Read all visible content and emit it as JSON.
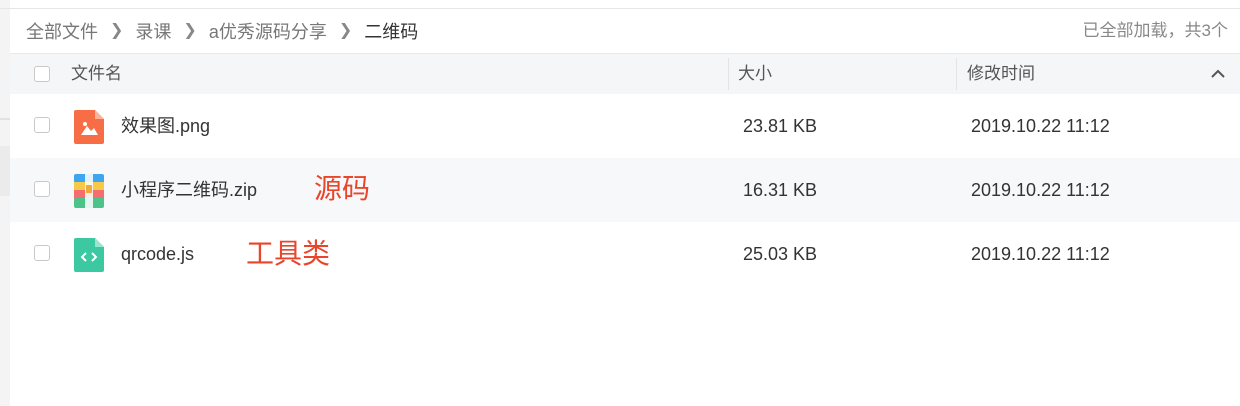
{
  "breadcrumb": {
    "items": [
      "全部文件",
      "录课",
      "a优秀源码分享",
      "二维码"
    ],
    "separator": ">"
  },
  "load_status": "已全部加载，共3个",
  "table": {
    "columns": {
      "name": "文件名",
      "size": "大小",
      "modified": "修改时间"
    },
    "rows": [
      {
        "name": "效果图.png",
        "size": "23.81 KB",
        "modified": "2019.10.22 11:12",
        "icon": "image-file-icon",
        "annotation": ""
      },
      {
        "name": "小程序二维码.zip",
        "size": "16.31 KB",
        "modified": "2019.10.22 11:12",
        "icon": "zip-file-icon",
        "annotation": "源码"
      },
      {
        "name": "qrcode.js",
        "size": "25.03 KB",
        "modified": "2019.10.22 11:12",
        "icon": "code-file-icon",
        "annotation": "工具类"
      }
    ]
  },
  "colors": {
    "image_icon": "#f76d45",
    "code_icon": "#3cc8a0",
    "annotation": "#e8452b"
  }
}
